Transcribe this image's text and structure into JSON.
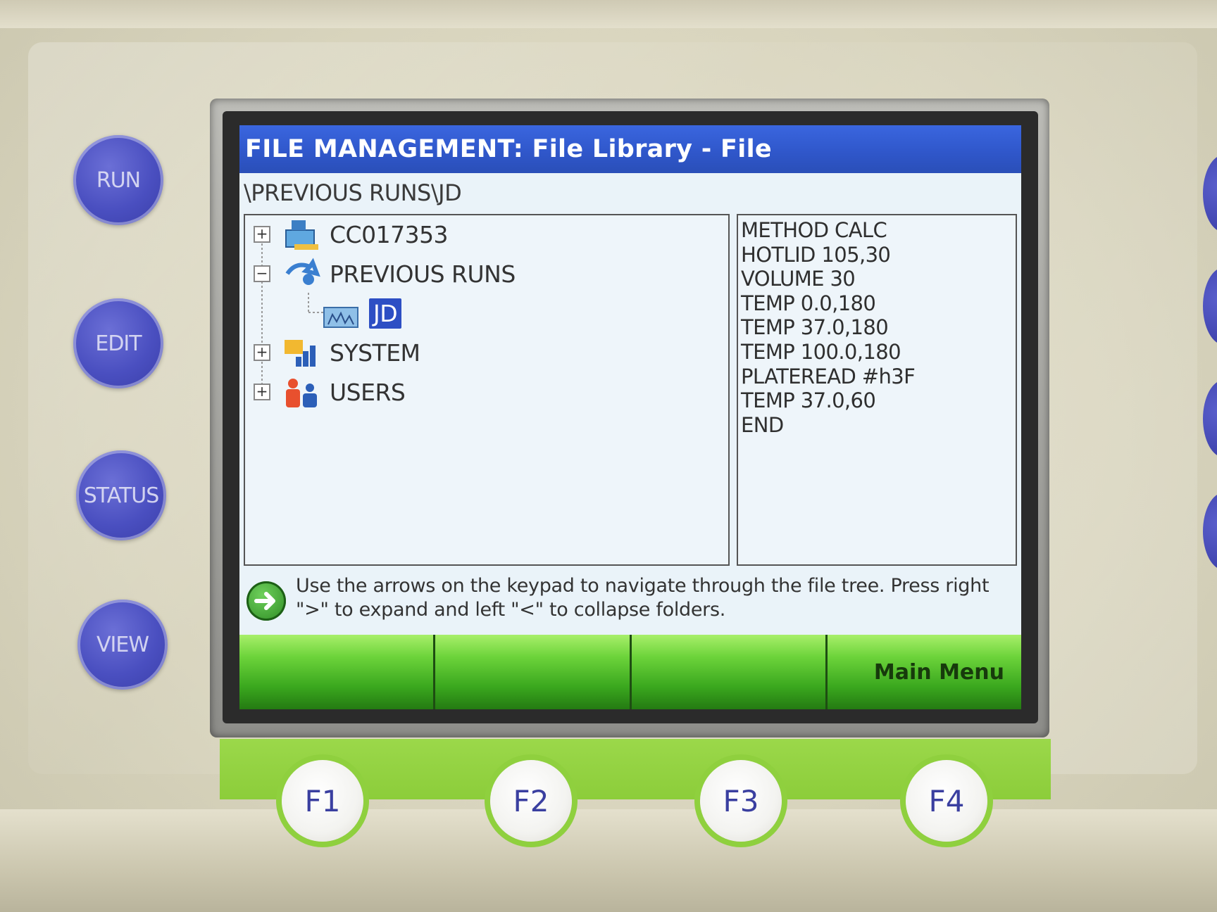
{
  "side_keys": [
    "RUN",
    "EDIT",
    "STATUS",
    "VIEW"
  ],
  "window": {
    "title": "FILE MANAGEMENT: File Library - File",
    "path": "\\PREVIOUS RUNS\\JD"
  },
  "tree": {
    "items": [
      {
        "label": "CC017353",
        "expander": "+",
        "icon": "network-folder-icon"
      },
      {
        "label": "PREVIOUS RUNS",
        "expander": "−",
        "icon": "history-folder-icon"
      },
      {
        "label": "JD",
        "expander": "",
        "icon": "user-folder-icon",
        "selected": true
      },
      {
        "label": "SYSTEM",
        "expander": "+",
        "icon": "system-folder-icon"
      },
      {
        "label": "USERS",
        "expander": "+",
        "icon": "users-folder-icon"
      }
    ]
  },
  "method_lines": [
    "METHOD CALC",
    "HOTLID 105,30",
    "VOLUME 30",
    "TEMP 0.0,180",
    "TEMP 37.0,180",
    "TEMP 100.0,180",
    "PLATEREAD #h3F",
    "TEMP 37.0,60",
    "END"
  ],
  "hint": {
    "icon": "arrow-right-icon",
    "text": "Use the arrows on the keypad to navigate through the file tree.  Press right \">\" to expand and left \"<\" to collapse folders."
  },
  "softkeys": [
    "",
    "",
    "",
    "Main Menu"
  ],
  "function_keys": [
    "F1",
    "F2",
    "F3",
    "F4"
  ],
  "colors": {
    "title_bar": "#2f56c9",
    "selection": "#2d4fc4",
    "softkey_green": "#4cbb28",
    "side_key_blue": "#4a4fc0"
  }
}
